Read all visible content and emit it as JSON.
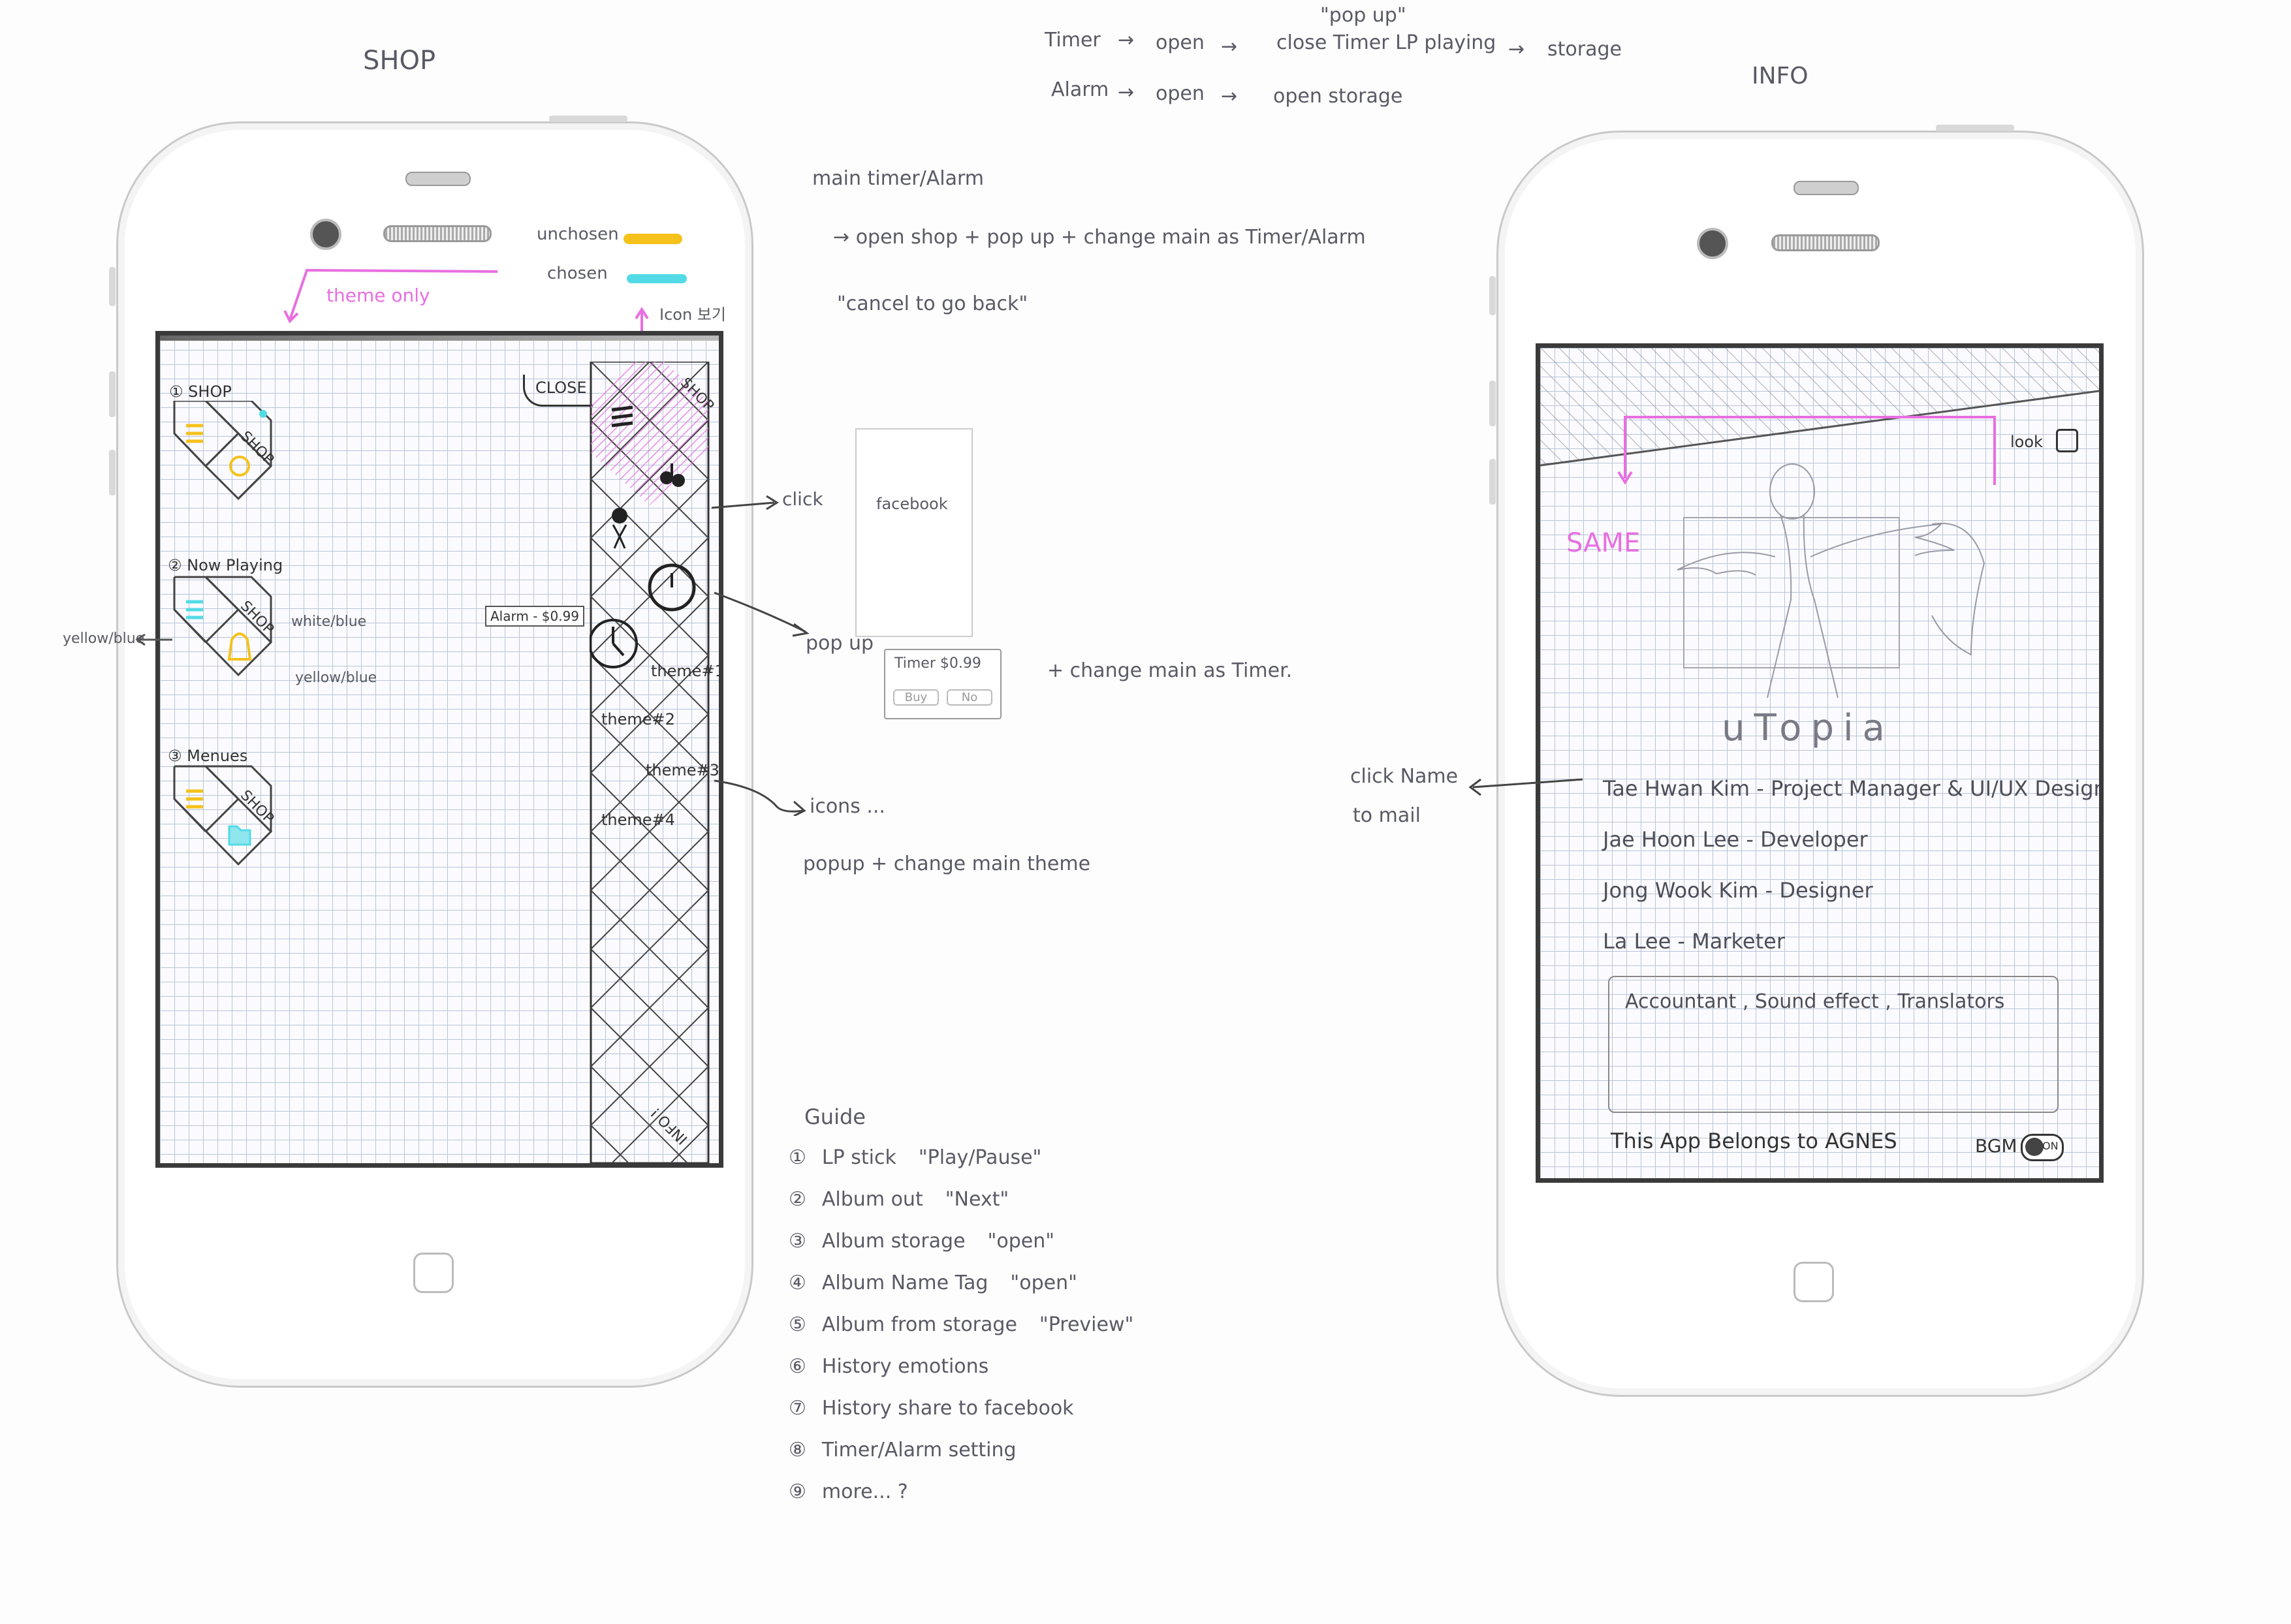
{
  "titles": {
    "shop": "SHOP",
    "info": "INFO"
  },
  "flow": {
    "popup_label": "\"pop up\"",
    "row1": [
      "Timer",
      "open",
      "close Timer LP playing",
      "storage"
    ],
    "row2": [
      "Alarm",
      "open",
      "open storage"
    ]
  },
  "legend": {
    "unchosen": "unchosen",
    "chosen": "chosen",
    "unchosen_color": "#f5c21b",
    "chosen_color": "#52dbe6"
  },
  "shop_notes": {
    "theme_only": "theme only",
    "icon_label": "Icon 보기"
  },
  "shop_screen": {
    "close_label": "CLOSE",
    "sections": [
      {
        "number": "①",
        "label": "SHOP"
      },
      {
        "number": "②",
        "label": "Now Playing"
      },
      {
        "number": "③",
        "label": "Menues"
      }
    ],
    "tile_shop_label": "SHOP",
    "alarm_price": "Alarm - $0.99",
    "themes": [
      "theme#1",
      "theme#2",
      "theme#3",
      "theme#4"
    ],
    "info_tile": "INFO !"
  },
  "side_labels": {
    "yellow_blue_left": "yellow/blue",
    "white_blue": "white/blue",
    "yellow_blue_right": "yellow/blue"
  },
  "middle_notes": {
    "main_line": "main timer/Alarm",
    "open_shop": "open shop + pop up + change main as Timer/Alarm",
    "cancel": "\"cancel to go back\"",
    "click": "click",
    "facebook": "facebook",
    "popup": "pop up",
    "timer_popup": "Timer $0.99",
    "popup_buttons": [
      "Buy",
      "No"
    ],
    "change_main": "+ change main as Timer.",
    "icons": "icons ...",
    "popup_theme": "popup + change main theme"
  },
  "guide": {
    "title": "Guide",
    "items": [
      {
        "n": "①",
        "text": "LP stick",
        "quote": "\"Play/Pause\""
      },
      {
        "n": "②",
        "text": "Album out",
        "quote": "\"Next\""
      },
      {
        "n": "③",
        "text": "Album storage",
        "quote": "\"open\""
      },
      {
        "n": "④",
        "text": "Album Name Tag",
        "quote": "\"open\""
      },
      {
        "n": "⑤",
        "text": "Album from storage",
        "quote": "\"Preview\""
      },
      {
        "n": "⑥",
        "text": "History emotions",
        "quote": ""
      },
      {
        "n": "⑦",
        "text": "History share to facebook",
        "quote": ""
      },
      {
        "n": "⑧",
        "text": "Timer/Alarm setting",
        "quote": ""
      },
      {
        "n": "⑨",
        "text": "more... ?",
        "quote": ""
      }
    ]
  },
  "info_screen": {
    "look_label": "look",
    "same_label": "SAME",
    "app_title": "uTopia",
    "team": [
      {
        "name": "Tae Hwan Kim",
        "role": "Project Manager & UI/UX Designer"
      },
      {
        "name": "Jae Hoon Lee",
        "role": "Developer"
      },
      {
        "name": "Jong Wook Kim",
        "role": "Designer"
      },
      {
        "name": "La Lee",
        "role": "Marketer"
      }
    ],
    "credits_box": "Accountant , Sound effect , Translators",
    "footer": "This App Belongs to AGNES",
    "bgm_label": "BGM",
    "bgm_state": "ON"
  },
  "info_note": {
    "line1": "click Name",
    "line2": "to mail"
  },
  "accent_pink": "#e86fe0",
  "grid_color": "#b9c4d6"
}
